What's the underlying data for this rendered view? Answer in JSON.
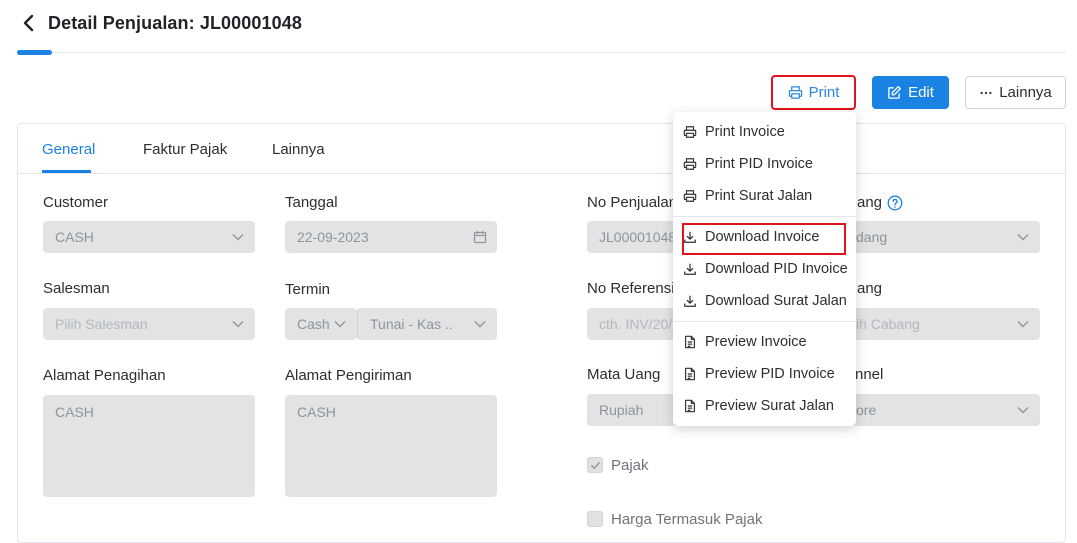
{
  "header": {
    "title": "Detail Penjualan: JL00001048"
  },
  "toolbar": {
    "print_label": "Print",
    "edit_label": "Edit",
    "more_label": "Lainnya"
  },
  "tabs": [
    {
      "label": "General"
    },
    {
      "label": "Faktur Pajak"
    },
    {
      "label": "Lainnya"
    }
  ],
  "form": {
    "customer": {
      "label": "Customer",
      "value": "CASH"
    },
    "tanggal": {
      "label": "Tanggal",
      "value": "22-09-2023"
    },
    "no_penjualan": {
      "label": "No Penjualan",
      "value": "JL00001048"
    },
    "gudang": {
      "label_partial": "ang",
      "value_partial": "dang"
    },
    "salesman": {
      "label": "Salesman",
      "placeholder": "Pilih Salesman"
    },
    "termin": {
      "label": "Termin",
      "type_value": "Cash",
      "value": "Tunai - Kas .."
    },
    "no_referensi": {
      "label": "No Referensi",
      "placeholder": "cth. INV/20/"
    },
    "cabang": {
      "label_partial": "ang",
      "placeholder_partial": "ih Cabang"
    },
    "alamat_penagihan": {
      "label": "Alamat Penagihan",
      "value": "CASH"
    },
    "alamat_pengiriman": {
      "label": "Alamat Pengiriman",
      "value": "CASH"
    },
    "mata_uang": {
      "label": "Mata Uang",
      "value": "Rupiah"
    },
    "channel": {
      "label_partial": "nnel",
      "value_partial": "ore"
    },
    "pajak": {
      "label": "Pajak",
      "checked": true
    },
    "harga_termasuk_pajak": {
      "label": "Harga Termasuk Pajak",
      "checked": false
    }
  },
  "print_menu": {
    "items": [
      {
        "label": "Print Invoice",
        "icon": "printer-icon"
      },
      {
        "label": "Print PID Invoice",
        "icon": "printer-icon"
      },
      {
        "label": "Print Surat Jalan",
        "icon": "printer-icon"
      },
      {
        "label": "Download Invoice",
        "icon": "download-icon"
      },
      {
        "label": "Download PID Invoice",
        "icon": "download-icon"
      },
      {
        "label": "Download Surat Jalan",
        "icon": "download-icon"
      },
      {
        "label": "Preview Invoice",
        "icon": "document-icon"
      },
      {
        "label": "Preview PID Invoice",
        "icon": "document-icon"
      },
      {
        "label": "Preview Surat Jalan",
        "icon": "document-icon"
      }
    ]
  },
  "colors": {
    "accent": "#1a82e2",
    "highlight": "#e3131b",
    "field_bg": "#e2e3e4"
  }
}
